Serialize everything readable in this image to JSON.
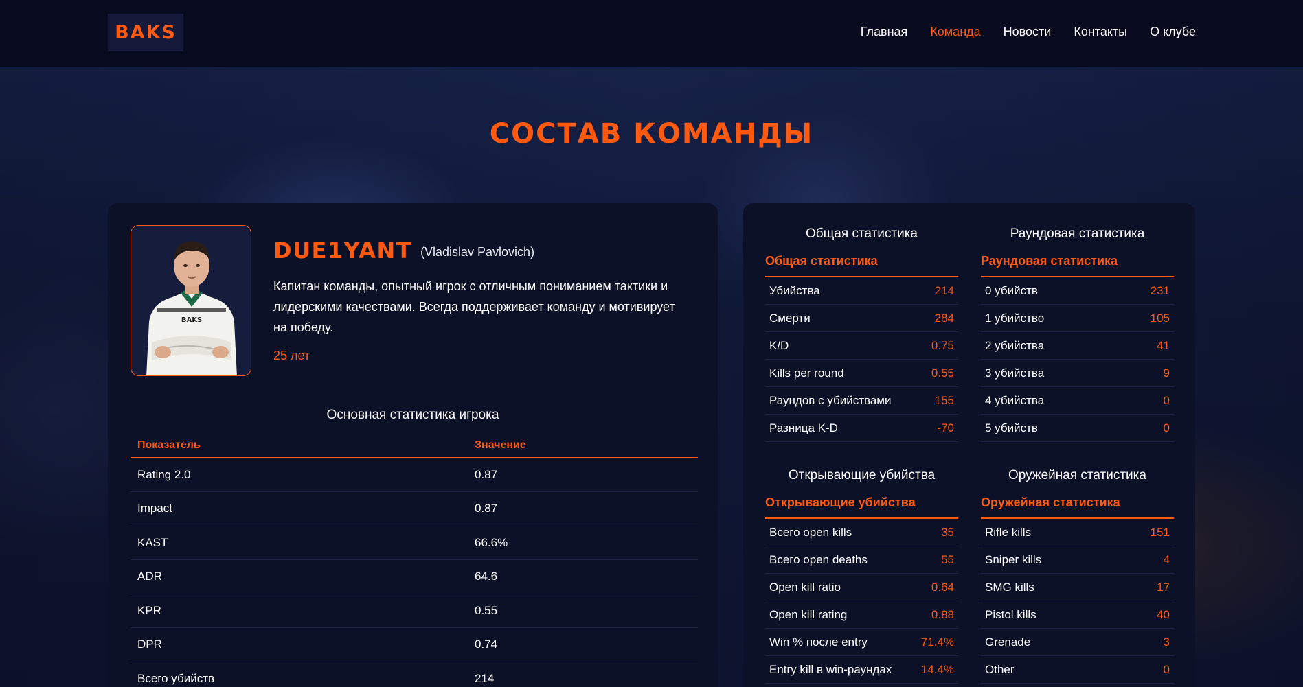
{
  "header": {
    "logo": "BAKS",
    "nav": [
      "Главная",
      "Команда",
      "Новости",
      "Контакты",
      "О клубе"
    ],
    "active_nav": "Команда"
  },
  "page": {
    "title": "Состав команды"
  },
  "player": {
    "nickname": "DUE1YANT",
    "real_name": "(Vladislav Pavlovich)",
    "bio": "Капитан команды, опытный игрок с отличным пониманием тактики и лидерскими качествами. Всегда поддерживает команду и мотивирует на победу.",
    "age": "25 лет",
    "photo_jersey_text": "BAKS"
  },
  "main_stats": {
    "title": "Основная статистика игрока",
    "headers": [
      "Показатель",
      "Значение"
    ],
    "rows": [
      [
        "Rating 2.0",
        "0.87"
      ],
      [
        "Impact",
        "0.87"
      ],
      [
        "KAST",
        "66.6%"
      ],
      [
        "ADR",
        "64.6"
      ],
      [
        "KPR",
        "0.55"
      ],
      [
        "DPR",
        "0.74"
      ],
      [
        "Всего убийств",
        "214"
      ]
    ]
  },
  "blocks": [
    {
      "title": "Общая статистика",
      "subtitle": "Общая статистика",
      "rows": [
        [
          "Убийства",
          "214"
        ],
        [
          "Смерти",
          "284"
        ],
        [
          "K/D",
          "0.75"
        ],
        [
          "Kills per round",
          "0.55"
        ],
        [
          "Раундов с убийствами",
          "155"
        ],
        [
          "Разница K-D",
          "-70"
        ]
      ]
    },
    {
      "title": "Раундовая статистика",
      "subtitle": "Раундовая статистика",
      "rows": [
        [
          "0 убийств",
          "231"
        ],
        [
          "1 убийство",
          "105"
        ],
        [
          "2 убийства",
          "41"
        ],
        [
          "3 убийства",
          "9"
        ],
        [
          "4 убийства",
          "0"
        ],
        [
          "5 убийств",
          "0"
        ]
      ]
    },
    {
      "title": "Открывающие убийства",
      "subtitle": "Открывающие убийства",
      "rows": [
        [
          "Всего open kills",
          "35"
        ],
        [
          "Всего open deaths",
          "55"
        ],
        [
          "Open kill ratio",
          "0.64"
        ],
        [
          "Open kill rating",
          "0.88"
        ],
        [
          "Win % после entry",
          "71.4%"
        ],
        [
          "Entry kill в win-раундах",
          "14.4%"
        ]
      ]
    },
    {
      "title": "Оружейная статистика",
      "subtitle": "Оружейная статистика",
      "rows": [
        [
          "Rifle kills",
          "151"
        ],
        [
          "Sniper kills",
          "4"
        ],
        [
          "SMG kills",
          "17"
        ],
        [
          "Pistol kills",
          "40"
        ],
        [
          "Grenade",
          "3"
        ],
        [
          "Other",
          "0"
        ]
      ]
    }
  ],
  "colors": {
    "accent": "#ff5a10",
    "panel": "#0c1128",
    "header": "#080b1e"
  }
}
